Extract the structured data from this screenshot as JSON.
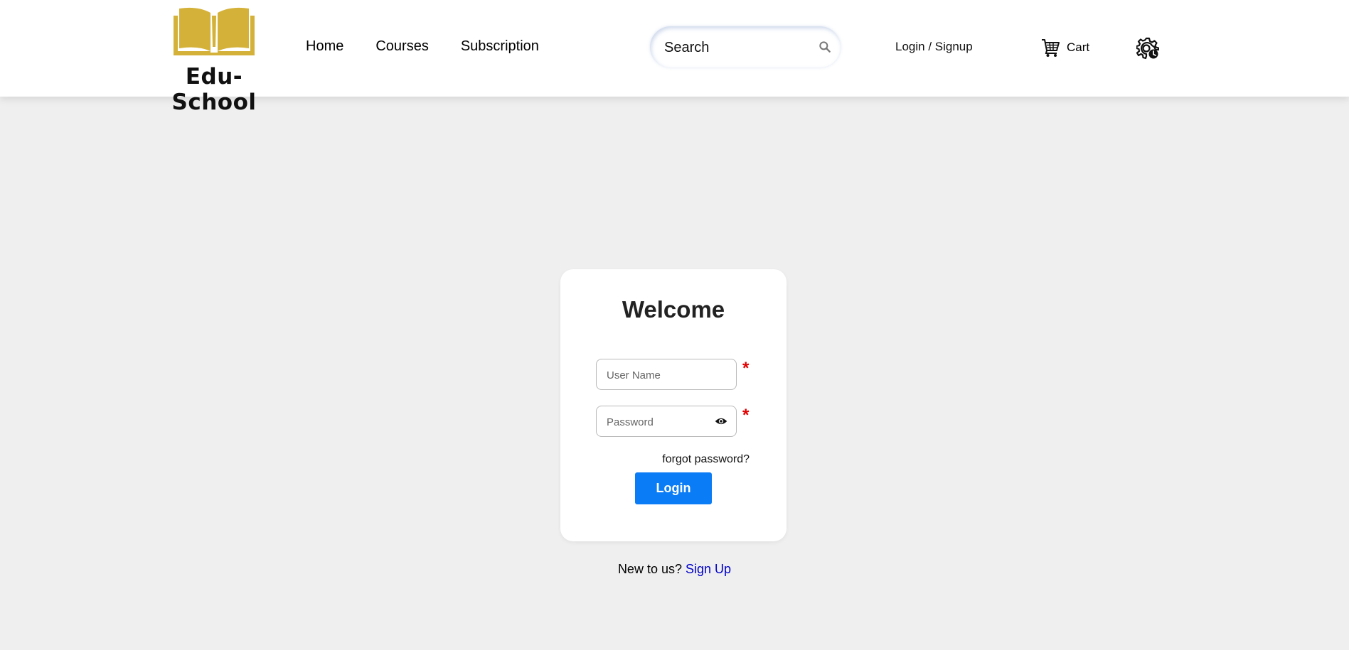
{
  "brand": {
    "name": "Edu-School",
    "logo_icon": "open-book-icon",
    "logo_color": "#d4b23a"
  },
  "nav": {
    "items": [
      {
        "label": "Home"
      },
      {
        "label": "Courses"
      },
      {
        "label": "Subscription"
      }
    ]
  },
  "search": {
    "placeholder": "Search",
    "icon": "search-icon"
  },
  "header": {
    "login_label": "Login / Signup",
    "cart_label": "Cart",
    "cart_icon": "cart-icon",
    "settings_icon": "gear-icon"
  },
  "login_form": {
    "title": "Welcome",
    "username_placeholder": "User Name",
    "password_placeholder": "Password",
    "required_marker": "*",
    "forgot_label": "forgot password?",
    "submit_label": "Login",
    "button_color": "#0a7cf5"
  },
  "signup": {
    "prompt": "New to us?",
    "link_label": "Sign Up"
  }
}
